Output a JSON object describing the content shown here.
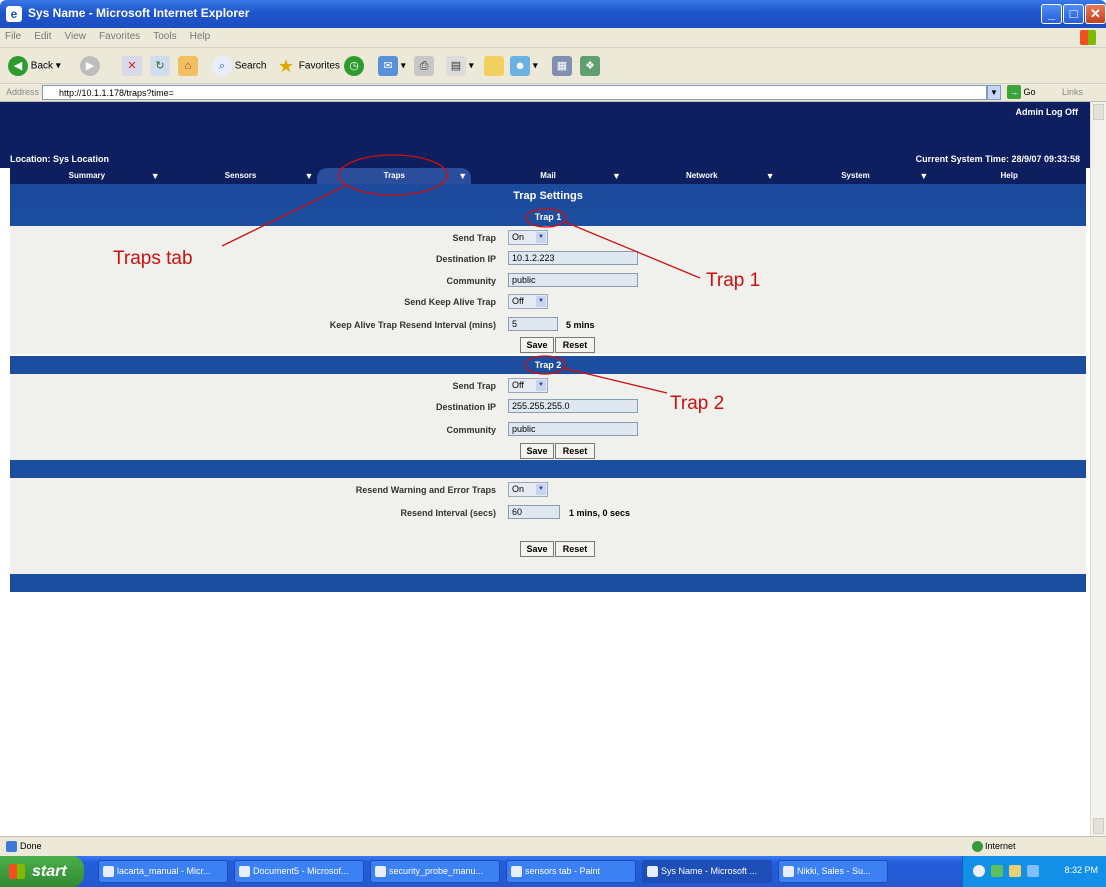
{
  "window": {
    "title": "Sys Name - Microsoft Internet Explorer",
    "menu": [
      "File",
      "Edit",
      "View",
      "Favorites",
      "Tools",
      "Help"
    ],
    "toolbar": {
      "back": "Back",
      "search": "Search",
      "favorites": "Favorites"
    },
    "address_label": "Address",
    "address": "http://10.1.1.178/traps?time=",
    "go": "Go",
    "links": "Links"
  },
  "header": {
    "admin_logoff": "Admin Log Off",
    "location": "Location: Sys Location",
    "system_time": "Current System Time: 28/9/07 09:33:58"
  },
  "tabs": [
    "Summary",
    "Sensors",
    "Traps",
    "Mail",
    "Network",
    "System",
    "Help"
  ],
  "active_tab": "Traps",
  "page_title": "Trap Settings",
  "trap1": {
    "title": "Trap 1",
    "send_trap_label": "Send Trap",
    "send_trap_value": "On",
    "destination_ip_label": "Destination IP",
    "destination_ip_value": "10.1.2.223",
    "community_label": "Community",
    "community_value": "public",
    "keep_alive_label": "Send Keep Alive Trap",
    "keep_alive_value": "Off",
    "resend_interval_label": "Keep Alive Trap Resend Interval (mins)",
    "resend_interval_value": "5",
    "resend_interval_suffix": "5 mins",
    "save": "Save",
    "reset": "Reset"
  },
  "trap2": {
    "title": "Trap 2",
    "send_trap_label": "Send Trap",
    "send_trap_value": "Off",
    "destination_ip_label": "Destination IP",
    "destination_ip_value": "255.255.255.0",
    "community_label": "Community",
    "community_value": "public",
    "save": "Save",
    "reset": "Reset"
  },
  "resend": {
    "warning_label": "Resend Warning and Error Traps",
    "warning_value": "On",
    "interval_label": "Resend Interval (secs)",
    "interval_value": "60",
    "interval_suffix": "1 mins, 0 secs",
    "save": "Save",
    "reset": "Reset"
  },
  "annotations": {
    "traps_tab": "Traps tab",
    "trap1": "Trap 1",
    "trap2": "Trap 2",
    "color": "#cc1010"
  },
  "status": {
    "text": "Done",
    "zone": "Internet"
  },
  "taskbar": {
    "start": "start",
    "tasks": [
      "lacarta_manual - Micr...",
      "Document5 - Microsof...",
      "security_probe_manu...",
      "sensors tab - Paint",
      "Sys Name - Microsoft ...",
      "Nikki, Sales - Su..."
    ],
    "clock": "8:32 PM"
  },
  "colors": {
    "header": "#0d1f5e",
    "section_bar": "#1d4d9e",
    "body_bg": "#f0f0ec"
  }
}
